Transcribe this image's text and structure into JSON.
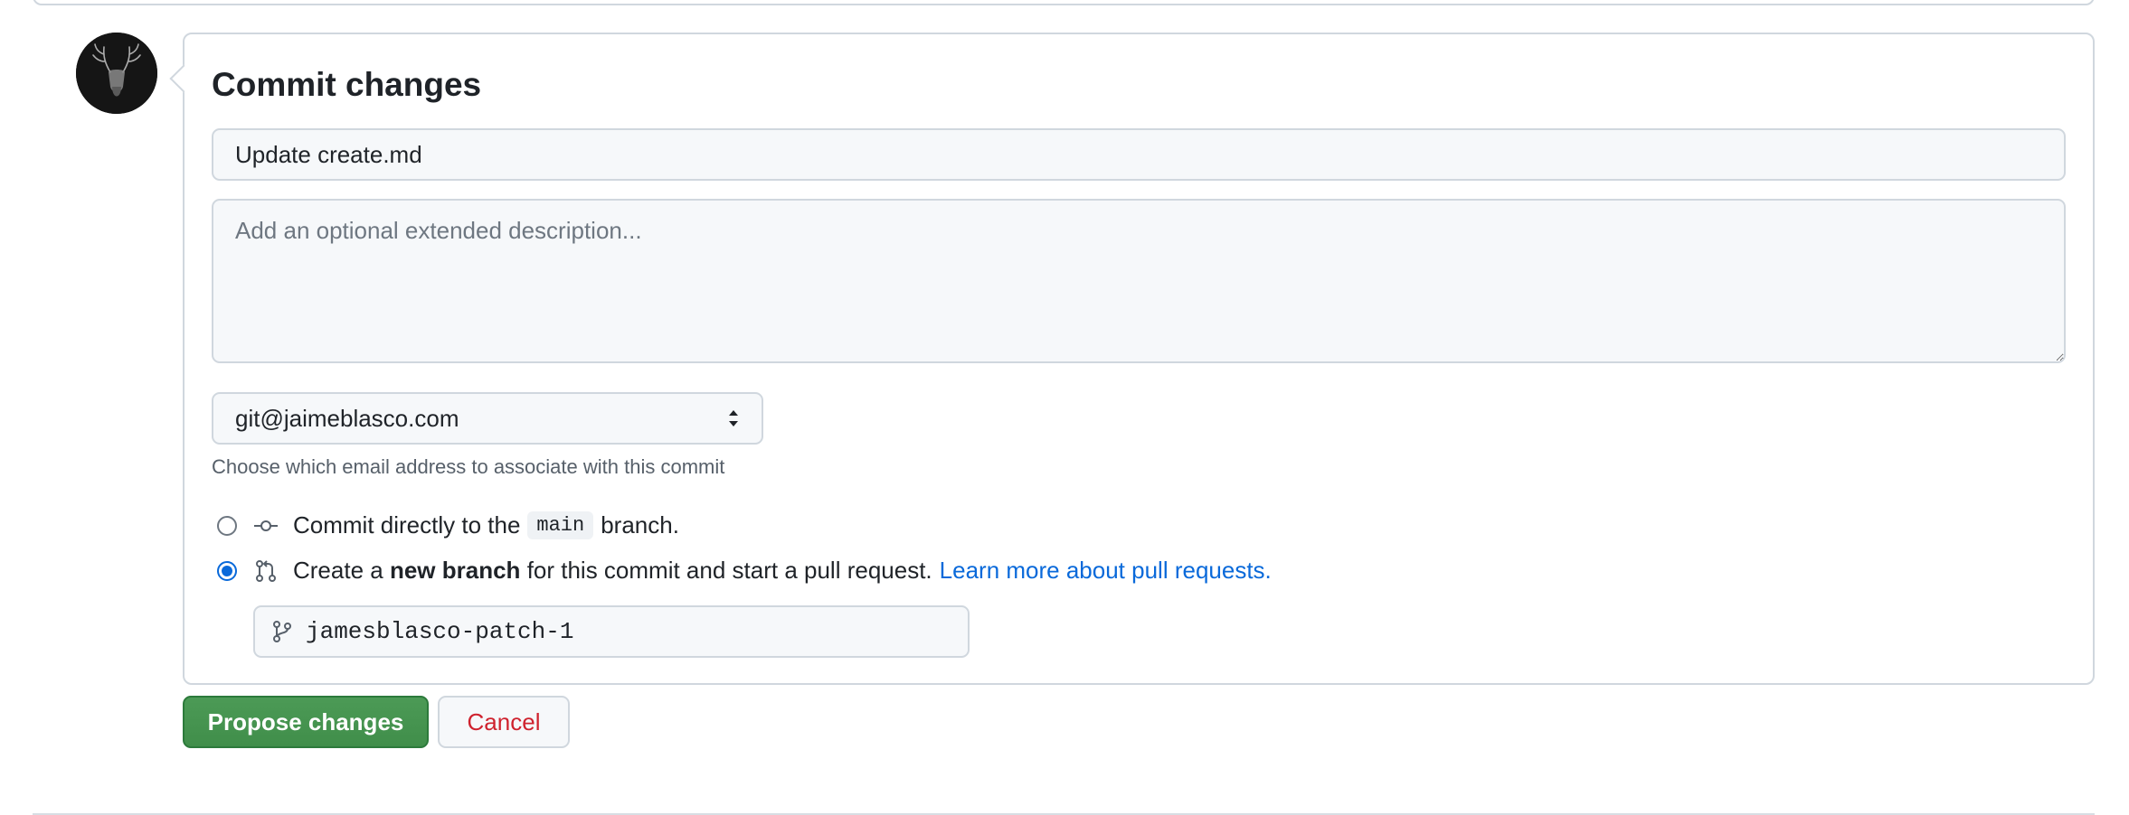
{
  "commit": {
    "title": "Commit changes",
    "summary_value": "Update create.md",
    "description_placeholder": "Add an optional extended description...",
    "email": {
      "selected": "git@jaimeblasco.com",
      "hint": "Choose which email address to associate with this commit"
    },
    "options": {
      "direct": {
        "prefix": "Commit directly to the",
        "branch": "main",
        "suffix": "branch.",
        "checked": false
      },
      "new_branch": {
        "prefix": "Create a",
        "emphasis": "new branch",
        "suffix": "for this commit and start a pull request.",
        "link": "Learn more about pull requests.",
        "checked": true
      }
    },
    "branch_name_value": "jamesblasco-patch-1"
  },
  "actions": {
    "propose_label": "Propose changes",
    "cancel_label": "Cancel"
  },
  "icons": {
    "avatar": "stag-avatar",
    "commit": "git-commit-icon",
    "pull_request": "git-pull-request-icon",
    "branch": "git-branch-icon",
    "select": "select-arrows-icon"
  },
  "colors": {
    "primary_button": "#408e4a",
    "danger_text": "#cf222e",
    "link": "#0969da",
    "border": "#d0d7de"
  }
}
